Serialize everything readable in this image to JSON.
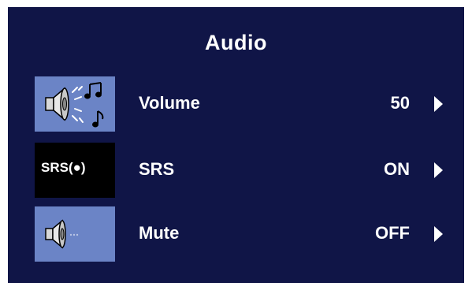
{
  "menu": {
    "title": "Audio",
    "items": [
      {
        "label": "Volume",
        "value": "50",
        "icon": "speaker-music-icon"
      },
      {
        "label": "SRS",
        "value": "ON",
        "icon": "srs-logo-icon",
        "icon_text": "SRS(●)"
      },
      {
        "label": "Mute",
        "value": "OFF",
        "icon": "speaker-mute-icon"
      }
    ]
  },
  "colors": {
    "background": "#101547",
    "icon_tile": "#6b84c6",
    "text": "#ffffff"
  }
}
